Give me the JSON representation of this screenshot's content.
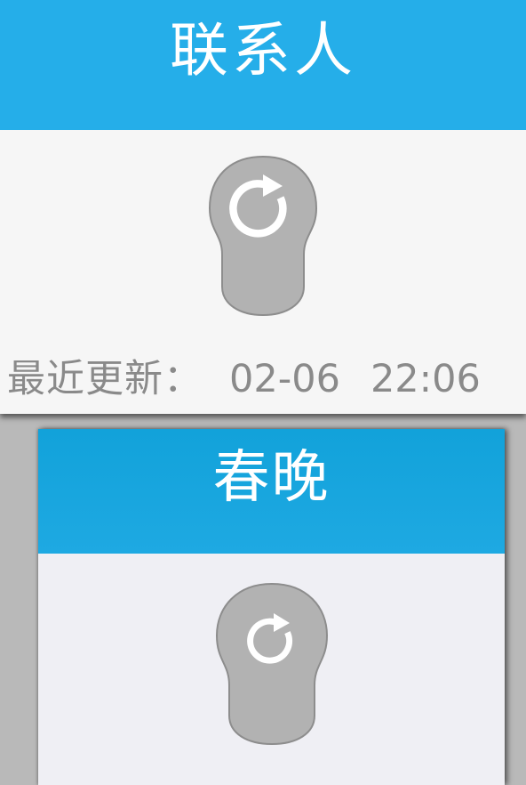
{
  "panels": [
    {
      "title": "联系人",
      "refresh_icon": "refresh-icon",
      "last_updated": {
        "label": "最近更新：",
        "date": "02-06",
        "time": "22:06"
      }
    },
    {
      "title": "春晚",
      "refresh_icon": "refresh-icon"
    }
  ],
  "colors": {
    "header_blue": "#25aee9",
    "header_blue_dark": "#12a2da",
    "droplet_gray": "#b2b2b2",
    "text_gray": "#8a8a8a"
  }
}
